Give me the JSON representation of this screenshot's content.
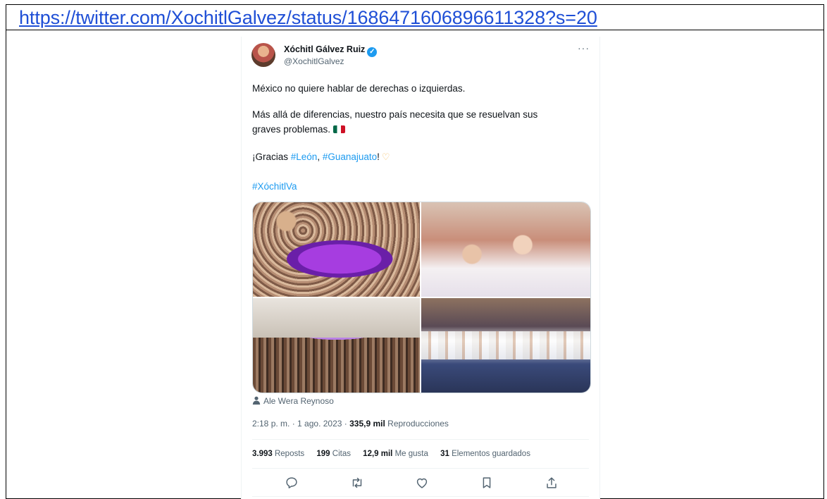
{
  "url": "https://twitter.com/XochitlGalvez/status/1686471606896611328?s=20",
  "tweet": {
    "author_name": "Xóchitl Gálvez Ruiz",
    "handle": "@XochitlGalvez",
    "more": "···",
    "text": {
      "line1": "México no quiere hablar de derechas o izquierdas.",
      "line2": "Más allá de diferencias, nuestro país necesita que se resuelvan sus",
      "line3": "graves problemas.",
      "thanks_prefix": "¡Gracias ",
      "hashtag_leon": "#León",
      "comma": ", ",
      "hashtag_guanajuato": "#Guanajuato",
      "thanks_suffix": "!",
      "hashtag_xochitlva": "#XóchitlVa"
    },
    "photo_credit": "Ale Wera Reynoso",
    "meta": {
      "time": "2:18 p. m.",
      "dot1": " · ",
      "date": "1 ago. 2023",
      "dot2": " · ",
      "views_count": "335,9 mil",
      "views_label": " Reproducciones"
    },
    "stats": {
      "reposts_count": "3.993",
      "reposts_label": " Reposts",
      "quotes_count": "199",
      "quotes_label": " Citas",
      "likes_count": "12,9 mil",
      "likes_label": " Me gusta",
      "bookmarks_count": "31",
      "bookmarks_label": " Elementos guardados"
    }
  },
  "colors": {
    "link": "#1f4fd6",
    "hashtag": "#1d9bf0",
    "verified": "#1d9bf0",
    "text": "#0f1419",
    "muted": "#536471"
  }
}
